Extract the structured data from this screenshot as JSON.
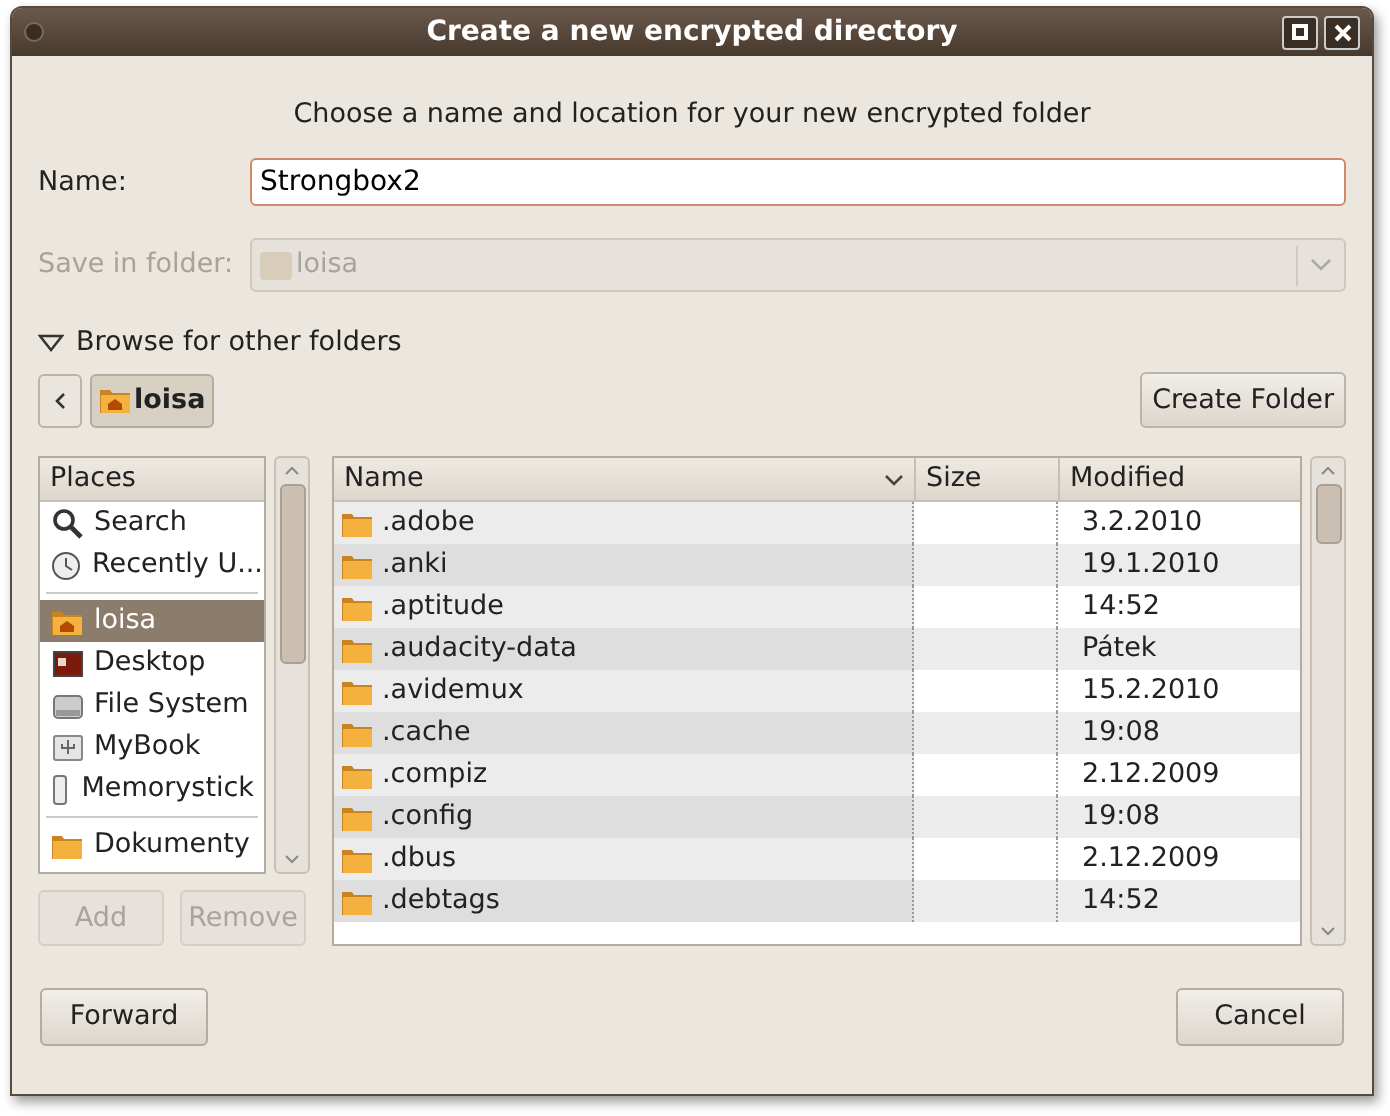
{
  "window": {
    "title": "Create a new encrypted directory"
  },
  "heading": "Choose a name and location for your new encrypted folder",
  "name_field": {
    "label": "Name:",
    "value": "Strongbox2"
  },
  "save_in_folder": {
    "label": "Save in folder:",
    "value": "loisa",
    "disabled": true
  },
  "browse_toggle": {
    "label": "Browse for other folders",
    "expanded": true
  },
  "path_bar": {
    "crumbs": [
      {
        "label": "loisa",
        "selected": true
      }
    ]
  },
  "create_folder_button": "Create Folder",
  "places": {
    "header": "Places",
    "groups": [
      [
        {
          "label": "Search",
          "kind": "search",
          "selected": false
        },
        {
          "label": "Recently U...",
          "kind": "recent",
          "selected": false
        }
      ],
      [
        {
          "label": "loisa",
          "kind": "home",
          "selected": true
        },
        {
          "label": "Desktop",
          "kind": "desktop",
          "selected": false
        },
        {
          "label": "File System",
          "kind": "disk",
          "selected": false
        },
        {
          "label": "MyBook",
          "kind": "usb",
          "selected": false
        },
        {
          "label": "Memorystick",
          "kind": "stick",
          "selected": false
        }
      ],
      [
        {
          "label": "Dokumenty",
          "kind": "folder",
          "selected": false
        }
      ]
    ]
  },
  "place_buttons": [
    {
      "label": "Add",
      "disabled": true
    },
    {
      "label": "Remove",
      "disabled": true
    }
  ],
  "files": {
    "columns": [
      "Name",
      "Size",
      "Modified"
    ],
    "rows": [
      {
        "name": ".adobe",
        "modified": "3.2.2010"
      },
      {
        "name": ".anki",
        "modified": "19.1.2010"
      },
      {
        "name": ".aptitude",
        "modified": "14:52"
      },
      {
        "name": ".audacity-data",
        "modified": "Pátek"
      },
      {
        "name": ".avidemux",
        "modified": "15.2.2010"
      },
      {
        "name": ".cache",
        "modified": "19:08"
      },
      {
        "name": ".compiz",
        "modified": "2.12.2009"
      },
      {
        "name": ".config",
        "modified": "19:08"
      },
      {
        "name": ".dbus",
        "modified": "2.12.2009"
      },
      {
        "name": ".debtags",
        "modified": "14:52"
      }
    ]
  },
  "buttons": [
    {
      "label": "Forward"
    },
    {
      "label": "Cancel"
    }
  ]
}
